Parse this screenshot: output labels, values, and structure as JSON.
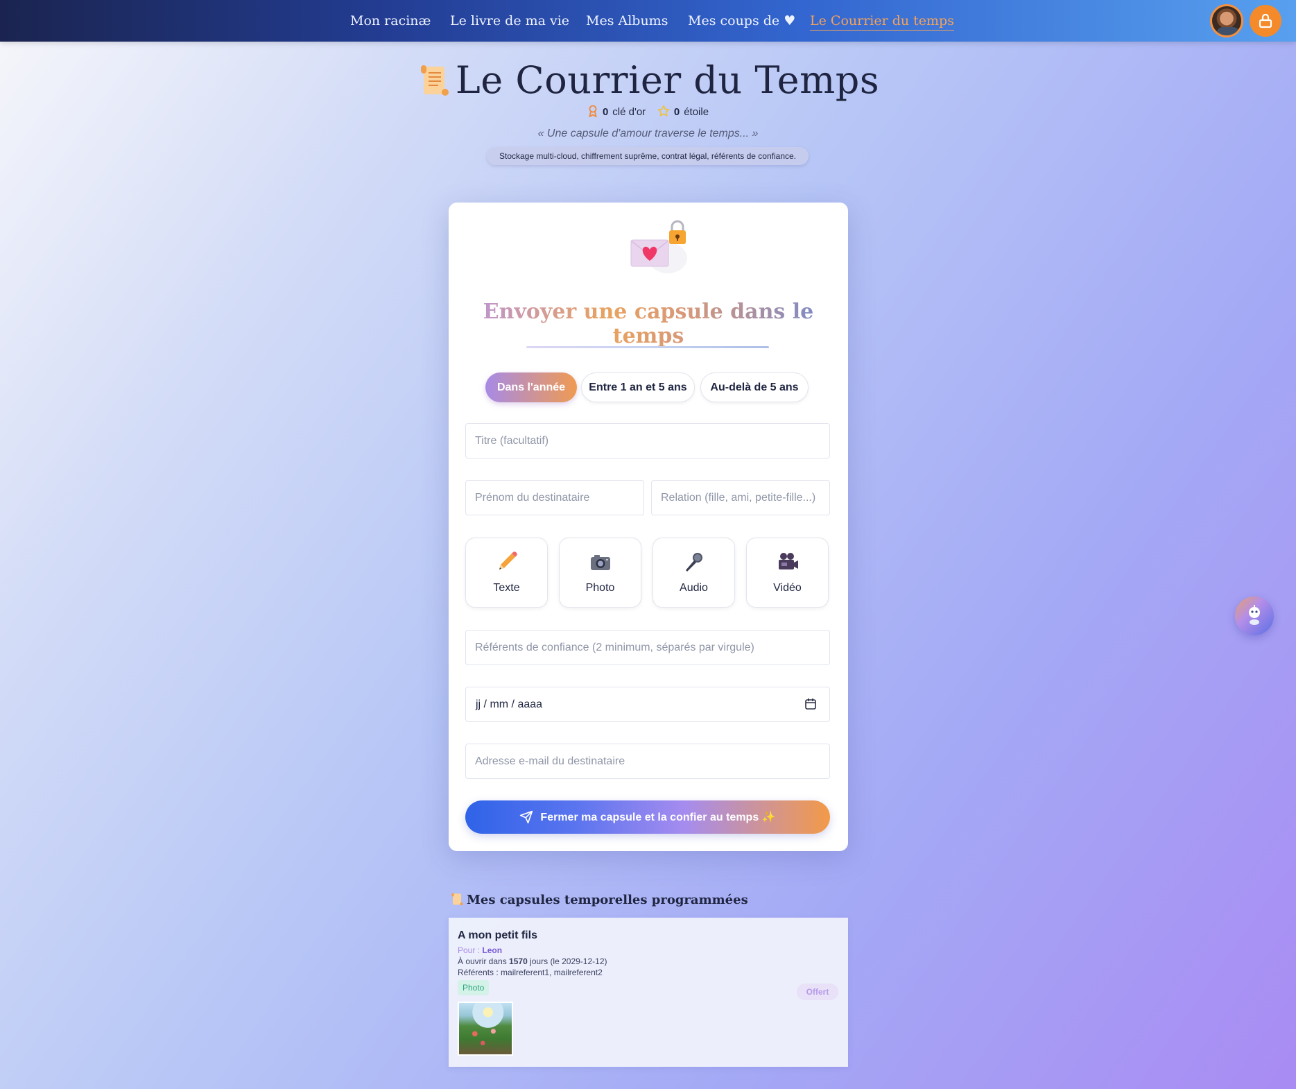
{
  "nav": {
    "links": [
      "Mon racinæ",
      "Le livre de ma vie",
      "Mes Albums",
      "Mes coups de ♥",
      "Le Courrier du temps"
    ],
    "active_index": 4,
    "accent_color": "#f5a259"
  },
  "header": {
    "title": "Le Courrier du Temps",
    "gold_keys_count": "0",
    "gold_keys_label": "clé d'or",
    "stars_count": "0",
    "stars_label": "étoile",
    "quote": "« Une capsule d'amour traverse le temps... »",
    "tagline": "Stockage multi-cloud, chiffrement suprême, contrat légal, référents de confiance."
  },
  "form": {
    "heading": "Envoyer une capsule dans le temps",
    "periods": [
      "Dans l'année",
      "Entre 1 an et 5 ans",
      "Au-delà de 5 ans"
    ],
    "selected_period": "Dans l'année",
    "title_placeholder": "Titre (facultatif)",
    "recipient_placeholder": "Prénom du destinataire",
    "relation_placeholder": "Relation (fille, ami, petite-fille...)",
    "media": [
      {
        "label": "Texte",
        "icon": "pencil-icon"
      },
      {
        "label": "Photo",
        "icon": "camera-icon"
      },
      {
        "label": "Audio",
        "icon": "microphone-icon"
      },
      {
        "label": "Vidéo",
        "icon": "movie-camera-icon"
      }
    ],
    "referents_placeholder": "Référents de confiance (2 minimum, séparés par virgule)",
    "date_placeholder": "jj / mm / aaaa",
    "email_placeholder": "Adresse e-mail du destinataire",
    "submit_label": "Fermer ma capsule et la confier au temps ✨"
  },
  "scheduled": {
    "section_title": "Mes capsules temporelles programmées",
    "capsules": [
      {
        "title": "A mon petit fils",
        "for_label": "Pour :",
        "recipient": "Leon",
        "open_prefix": "À ouvrir dans",
        "days": "1570",
        "open_suffix": "jours (le 2029-12-12)",
        "referents": "Référents : mailreferent1, mailreferent2",
        "media_badge": "Photo",
        "status": "Offert"
      }
    ]
  }
}
